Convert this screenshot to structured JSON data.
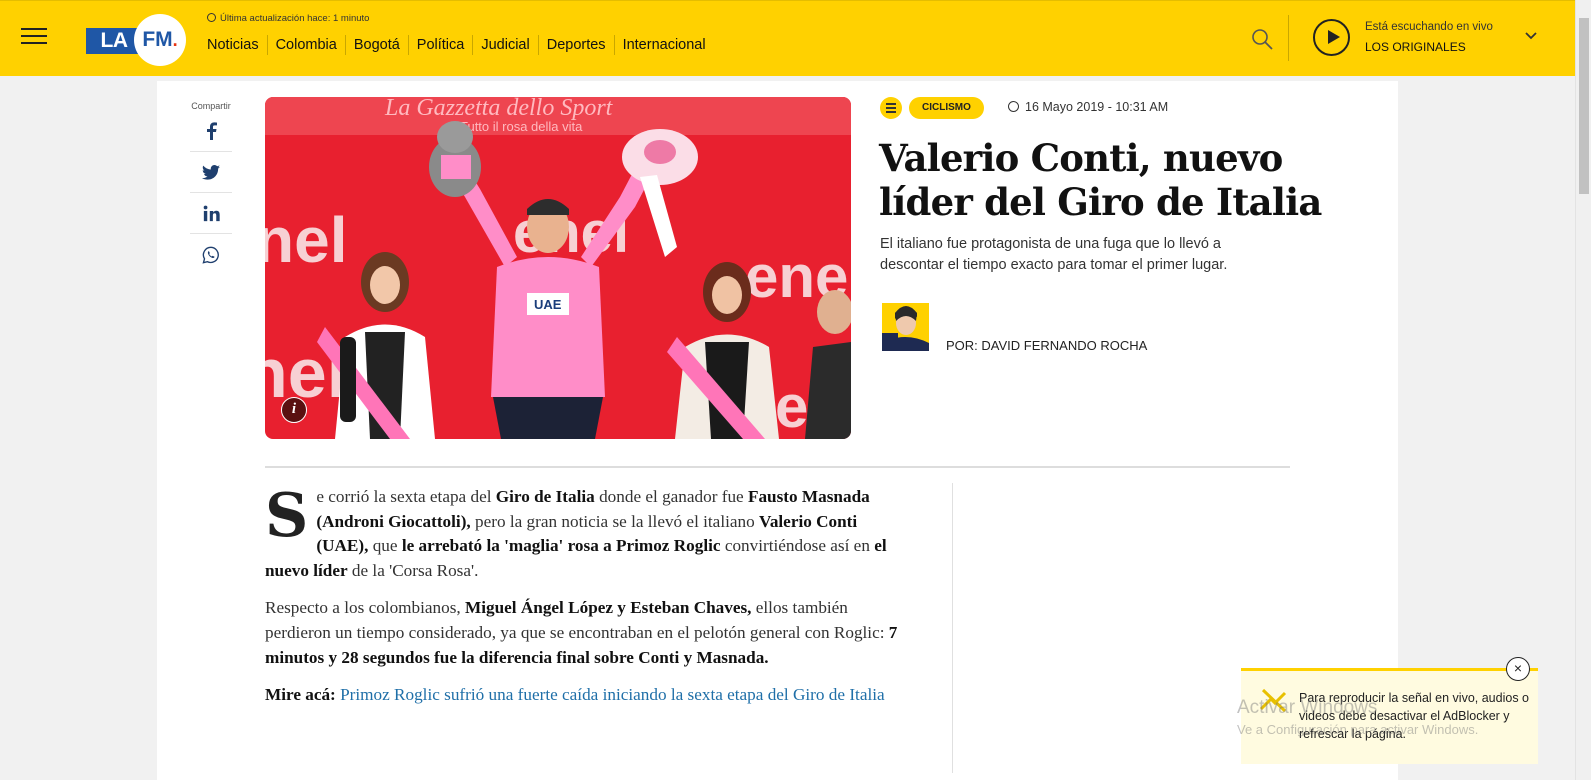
{
  "header": {
    "logo_text": "LAFM.",
    "last_update": "Última actualización hace: 1 minuto",
    "nav": [
      "Noticias",
      "Colombia",
      "Bogotá",
      "Política",
      "Judicial",
      "Deportes",
      "Internacional"
    ],
    "live_label": "Está escuchando en vivo",
    "live_program": "LOS ORIGINALES",
    "brand_color": "#ffd100"
  },
  "share": {
    "label": "Compartir",
    "items": [
      "facebook-icon",
      "twitter-icon",
      "linkedin-icon",
      "whatsapp-icon"
    ]
  },
  "article": {
    "photo_sign": "La Gazzetta dello Sport",
    "photo_sign_sub": "Tutto il rosa della vita",
    "category": "CICLISMO",
    "date": "16 Mayo 2019 - 10:31 AM",
    "title": "Valerio Conti, nuevo líder del Giro de Italia",
    "lead": "El italiano fue protagonista de una fuga que lo llevó a descontar el tiempo exacto para tomar el primer lugar.",
    "author": "POR: DAVID FERNANDO ROCHA",
    "body": {
      "p1": {
        "dropcap": "S",
        "t1": "e corrió la sexta etapa del ",
        "b1": "Giro de Italia",
        "t2": " donde el ganador fue ",
        "b2": "Fausto Masnada (Androni Giocattoli),",
        "t3": " pero la gran noticia se la llevó el italiano ",
        "b3": "Valerio Conti (UAE),",
        "t4": " que ",
        "b4": "le arrebató la 'maglia' rosa a Primoz Roglic",
        "t5": " convirtiéndose así en ",
        "b5": "el nuevo líder",
        "t6": " de la 'Corsa Rosa'."
      },
      "p2": {
        "t1": "Respecto a los colombianos, ",
        "b1": "Miguel Ángel López y Esteban Chaves,",
        "t2": " ellos también perdieron un tiempo considerado, ya que se encontraban en el pelotón general con Roglic: ",
        "b2": "7 minutos y 28 segundos fue la diferencia final sobre Conti y Masnada."
      },
      "p3": {
        "label": "Mire acá:",
        "link": "Primoz Roglic sufrió una fuerte caída iniciando la sexta etapa del Giro de Italia"
      }
    }
  },
  "notice": {
    "text": "Para reproducir la señal en vivo, audios o videos debe desactivar el AdBlocker y refrescar la página.",
    "close": "×"
  },
  "watermark": {
    "title": "Activar Windows",
    "subtitle": "Ve a Configuración para activar Windows."
  }
}
